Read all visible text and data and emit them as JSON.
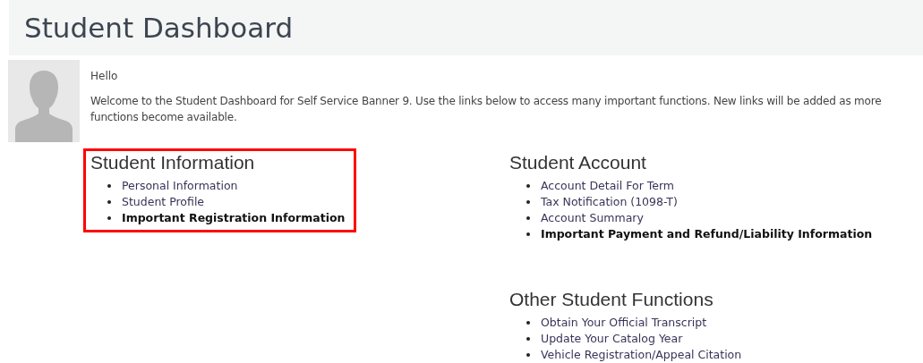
{
  "header": {
    "title": "Student Dashboard"
  },
  "greeting": "Hello",
  "welcome": "Welcome to the Student Dashboard for Self Service Banner 9. Use the links below to access many important functions. New links will be added as more functions become available.",
  "columns": [
    {
      "sections": [
        {
          "title": "Student Information",
          "highlighted": true,
          "links": [
            {
              "label": "Personal Information",
              "bold": false
            },
            {
              "label": "Student Profile",
              "bold": false
            },
            {
              "label": "Important Registration Information",
              "bold": true
            }
          ]
        }
      ]
    },
    {
      "sections": [
        {
          "title": "Student Account",
          "highlighted": false,
          "links": [
            {
              "label": "Account Detail For Term",
              "bold": false
            },
            {
              "label": "Tax Notification (1098-T)",
              "bold": false
            },
            {
              "label": "Account Summary",
              "bold": false
            },
            {
              "label": "Important Payment and Refund/Liability Information",
              "bold": true
            }
          ]
        },
        {
          "title": "Other Student Functions",
          "highlighted": false,
          "links": [
            {
              "label": "Obtain Your Official Transcript",
              "bold": false
            },
            {
              "label": "Update Your Catalog Year",
              "bold": false
            },
            {
              "label": "Vehicle Registration/Appeal Citation",
              "bold": false
            }
          ]
        }
      ]
    }
  ]
}
